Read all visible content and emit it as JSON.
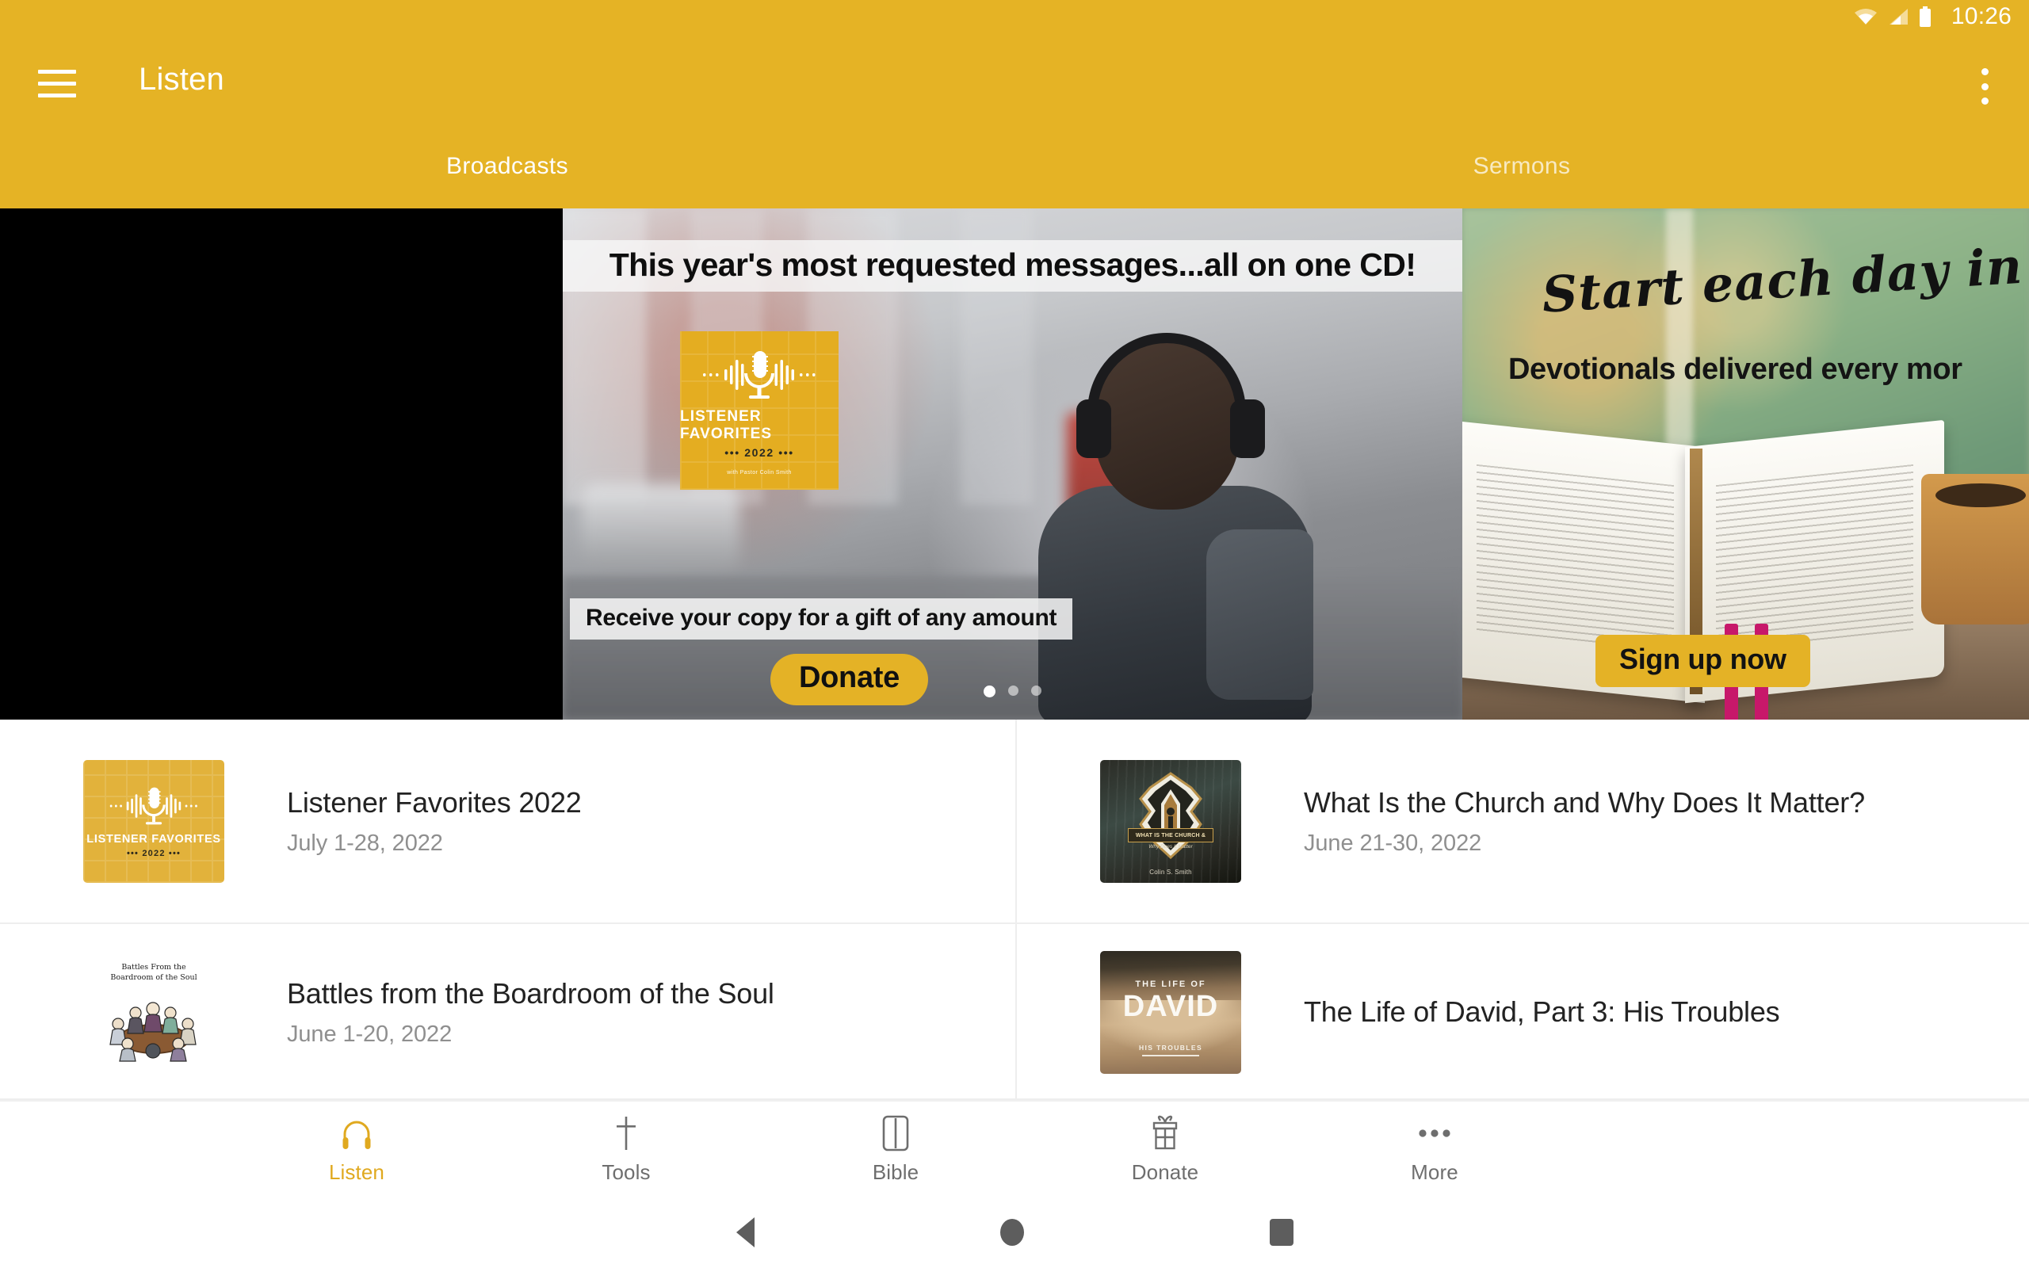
{
  "status_bar": {
    "time": "10:26",
    "icons": [
      "wifi-icon",
      "cell-signal-icon",
      "battery-icon"
    ]
  },
  "app_bar": {
    "menu_icon": "hamburger-menu-icon",
    "title": "Listen",
    "overflow_icon": "more-vertical-icon"
  },
  "tabs": [
    {
      "label": "Broadcasts",
      "active": true
    },
    {
      "label": "Sermons",
      "active": false
    }
  ],
  "carousel": {
    "dots": 3,
    "active_dot": 1,
    "banners": [
      {
        "name": "listener-favorites-banner",
        "headline": "This year's most requested messages...all on one CD!",
        "subhead": "Receive your copy for a gift of any amount",
        "cta": "Donate",
        "art": {
          "title": "LISTENER FAVORITES",
          "year": "••• 2022 •••",
          "byline": "with Pastor Colin Smith"
        }
      },
      {
        "name": "devotionals-banner",
        "headline": "Start each day in C",
        "subhead": "Devotionals delivered every mor",
        "cta": "Sign up now"
      }
    ]
  },
  "list": {
    "items": [
      {
        "title": "Listener Favorites 2022",
        "date": "July 1-28, 2022",
        "thumb": "listener-favorites-thumbnail",
        "thumb_text": {
          "t1": "LISTENER FAVORITES",
          "t2": "••• 2022 •••"
        }
      },
      {
        "title": "What Is the Church and Why Does It Matter?",
        "date": "June 21-30, 2022",
        "thumb": "what-is-the-church-thumbnail",
        "thumb_text": {
          "t1": "WHAT IS THE CHURCH &",
          "t2": "Why Does It Matter",
          "author": "Colin S. Smith"
        }
      },
      {
        "title": "Battles from the Boardroom of the Soul",
        "date": "June 1-20, 2022",
        "thumb": "battles-boardroom-thumbnail",
        "thumb_text": {
          "line1": "Battles From the",
          "line2": "Boardroom of the Soul"
        }
      },
      {
        "title": "The Life of David, Part 3: His Troubles",
        "date": "",
        "thumb": "life-of-david-thumbnail",
        "thumb_text": {
          "t0": "THE LIFE OF",
          "t1": "DAVID",
          "t2": "HIS TROUBLES"
        }
      }
    ]
  },
  "bottom_nav": {
    "items": [
      {
        "label": "Listen",
        "icon": "headphones-icon",
        "active": true
      },
      {
        "label": "Tools",
        "icon": "cross-icon",
        "active": false
      },
      {
        "label": "Bible",
        "icon": "book-icon",
        "active": false
      },
      {
        "label": "Donate",
        "icon": "gift-icon",
        "active": false
      },
      {
        "label": "More",
        "icon": "ellipsis-icon",
        "active": false
      }
    ]
  },
  "system_nav": {
    "back": "back-triangle-icon",
    "home": "home-circle-icon",
    "recents": "recents-square-icon"
  },
  "colors": {
    "brand_yellow": "#e5b325",
    "accent_yellow": "#e0a91f",
    "text_primary": "#222222",
    "text_secondary": "#8f8f8f"
  }
}
